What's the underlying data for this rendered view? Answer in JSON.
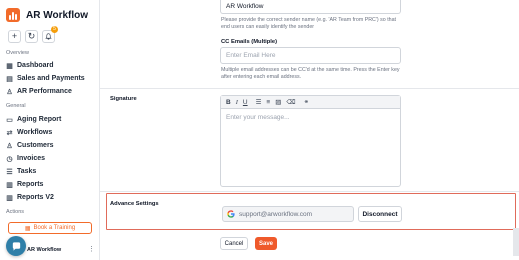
{
  "app": {
    "name": "AR Workflow",
    "notification_count": "5",
    "colors": {
      "brand": "#f26b2a",
      "save": "#ef5a2b",
      "highlight_border": "#e06b5a",
      "chat": "#2f7fa8"
    }
  },
  "sidebar": {
    "overview_label": "Overview",
    "overview_items": [
      {
        "label": "Dashboard",
        "icon": "grid-icon"
      },
      {
        "label": "Sales and Payments",
        "icon": "receipt-icon"
      },
      {
        "label": "AR Performance",
        "icon": "user-icon"
      }
    ],
    "general_label": "General",
    "general_items": [
      {
        "label": "Aging Report",
        "icon": "document-icon"
      },
      {
        "label": "Workflows",
        "icon": "workflow-icon"
      },
      {
        "label": "Customers",
        "icon": "users-icon"
      },
      {
        "label": "Invoices",
        "icon": "invoice-icon"
      },
      {
        "label": "Tasks",
        "icon": "tasks-icon"
      },
      {
        "label": "Reports",
        "icon": "reports-icon"
      },
      {
        "label": "Reports V2",
        "icon": "reports-icon"
      }
    ],
    "actions_label": "Actions",
    "training_button": "Book a Training",
    "footer_name": "AR Workflow"
  },
  "form": {
    "sender_name_value": "AR Workflow",
    "sender_help": "Please provide the correct sender name (e.g. 'AR Team from PRC') so that end users can easily identify the sender",
    "cc_label": "CC Emails (Multiple)",
    "cc_placeholder": "Enter Email Here",
    "cc_help": "Multiple email addresses can be CC'd at the same time. Press the Enter key after entering each email address.",
    "signature_label": "Signature",
    "signature_placeholder": "Enter your message...",
    "toolbar": {
      "bold": "B",
      "italic": "I",
      "underline": "U"
    },
    "advanced_label": "Advance Settings",
    "google_email": "support@arworkflow.com",
    "disconnect_label": "Disconnect",
    "cancel_label": "Cancel",
    "save_label": "Save"
  }
}
